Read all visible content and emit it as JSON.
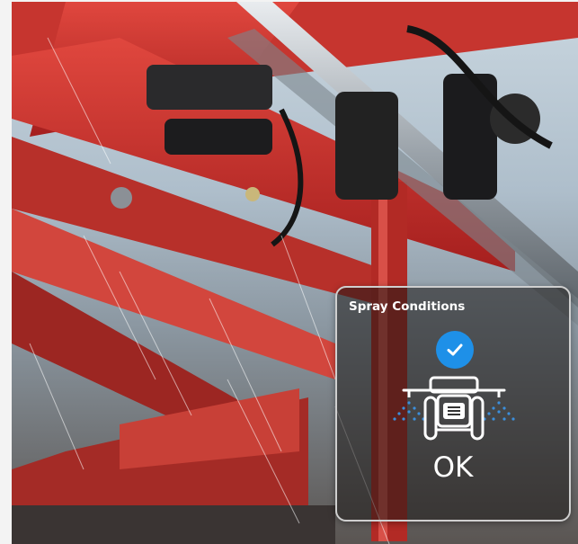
{
  "card": {
    "title": "Spray Conditions",
    "status": "OK"
  },
  "icons": {
    "check": "check-circle-icon",
    "tractor": "sprayer-tractor-icon"
  },
  "colors": {
    "check_blue": "#1e90e8",
    "spray_blue": "#3b8fdc"
  }
}
